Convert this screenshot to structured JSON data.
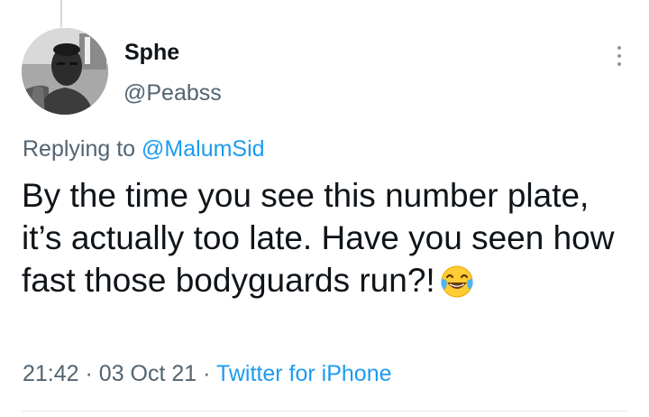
{
  "tweet": {
    "display_name": "Sphe",
    "handle": "@Peabss",
    "replying_prefix": "Replying to",
    "replying_to": "@MalumSid",
    "text": "By the time you see this number plate, it’s actually too late. Have you seen how fast those bodyguards run?!",
    "emoji": "face-with-tears-of-joy",
    "time": "21:42",
    "separator": "·",
    "date": "03 Oct 21",
    "source": "Twitter for iPhone"
  },
  "icons": {
    "more": "more-options-icon",
    "avatar": "profile-photo"
  },
  "colors": {
    "link": "#1d9bf0",
    "secondary_text": "#536471",
    "primary_text": "#0f1419"
  }
}
